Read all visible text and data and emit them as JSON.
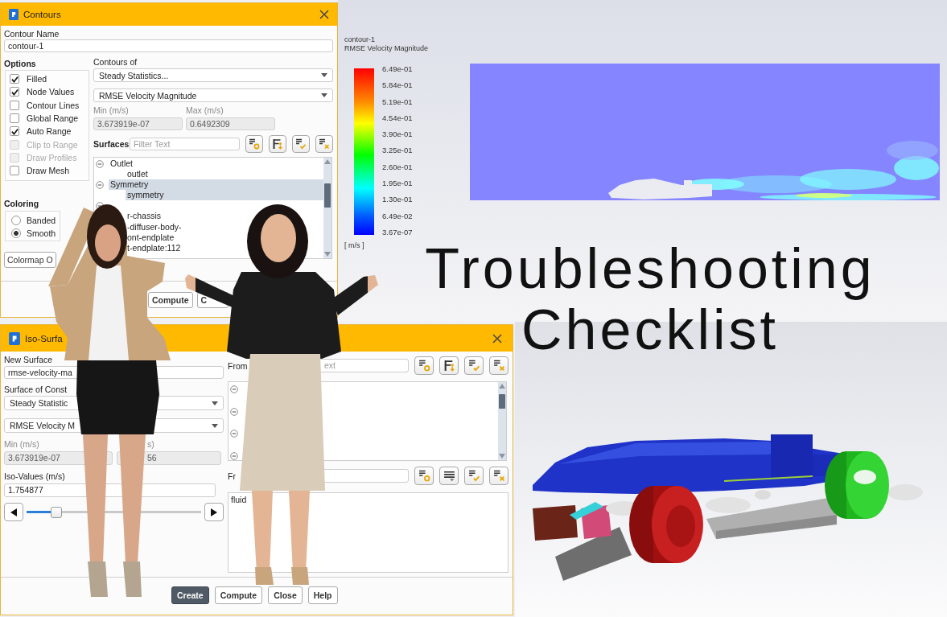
{
  "contours_dialog": {
    "title": "Contours",
    "name_label": "Contour Name",
    "name_value": "contour-1",
    "options_label": "Options",
    "options": [
      {
        "label": "Filled",
        "checked": true,
        "disabled": false
      },
      {
        "label": "Node Values",
        "checked": true,
        "disabled": false
      },
      {
        "label": "Contour Lines",
        "checked": false,
        "disabled": false
      },
      {
        "label": "Global Range",
        "checked": false,
        "disabled": false
      },
      {
        "label": "Auto Range",
        "checked": true,
        "disabled": false
      },
      {
        "label": "Clip to Range",
        "checked": false,
        "disabled": true
      },
      {
        "label": "Draw Profiles",
        "checked": false,
        "disabled": true
      },
      {
        "label": "Draw Mesh",
        "checked": false,
        "disabled": false
      }
    ],
    "coloring_label": "Coloring",
    "coloring": [
      {
        "label": "Banded",
        "selected": false
      },
      {
        "label": "Smooth",
        "selected": true
      }
    ],
    "colormap_button": "Colormap O",
    "contours_of_label": "Contours of",
    "contours_of": [
      "Steady Statistics...",
      "RMSE Velocity Magnitude"
    ],
    "range": [
      {
        "label": "Min (m/s)",
        "value": "3.673919e-07"
      },
      {
        "label": "Max (m/s)",
        "value": "0.6492309"
      }
    ],
    "surfaces_label": "Surfaces",
    "surfaces_filter": {
      "placeholder": "Filter Text"
    },
    "surfaces": [
      {
        "label": "Outlet",
        "expanded": true,
        "selected": false,
        "children": [
          {
            "label": "outlet",
            "selected": false
          }
        ]
      },
      {
        "label": "Symmetry",
        "expanded": true,
        "selected": true,
        "children": [
          {
            "label": "symmetry",
            "selected": true
          }
        ]
      },
      {
        "expanded": true,
        "children": [
          {
            "label": "r-chassis",
            "selected": false
          },
          {
            "label": "-diffuser-body-",
            "selected": false
          },
          {
            "label": "ont-endplate",
            "selected": false
          },
          {
            "label": "t-endplate:112",
            "selected": false
          }
        ]
      }
    ],
    "buttons": [
      "Compute",
      "C"
    ]
  },
  "iso_surface_dialog": {
    "title": "Iso-Surfa",
    "new_surface_label": "New Surface",
    "new_surface_value": "rmse-velocity-ma",
    "constant_label": "Surface of Const",
    "constant_of": [
      "Steady Statistic",
      "RMSE Velocity M"
    ],
    "range": [
      {
        "label": "Min (m/s)",
        "value": "3.673919e-07"
      },
      {
        "label": "s)",
        "value": "56"
      }
    ],
    "iso_values_label": "Iso-Values (m/s)",
    "iso_value": "1.754877",
    "slider": {
      "level": 0.17
    },
    "from_surface_label": "From",
    "from_surface_filter": {
      "placeholder": "ext"
    },
    "from_surface_tree": [
      {
        "expanded": true
      },
      {
        "expanded": true
      },
      {
        "expanded": true
      },
      {
        "expanded": true
      }
    ],
    "from_zones_label": "Fr",
    "from_zones": [
      "fluid"
    ],
    "buttons": [
      {
        "label": "Create",
        "primary": true
      },
      {
        "label": "Compute",
        "primary": false
      },
      {
        "label": "Close",
        "primary": false
      },
      {
        "label": "Help",
        "primary": false
      }
    ]
  },
  "viewport": {
    "legend": {
      "title": "contour-1",
      "quantity": "RMSE Velocity Magnitude",
      "labels": [
        "6.49e-01",
        "5.84e-01",
        "5.19e-01",
        "4.54e-01",
        "3.90e-01",
        "3.25e-01",
        "2.60e-01",
        "1.95e-01",
        "1.30e-01",
        "6.49e-02",
        "3.67e-07"
      ],
      "unit": "[ m/s ]"
    }
  },
  "headline": [
    "Troubleshooting",
    "Checklist"
  ]
}
